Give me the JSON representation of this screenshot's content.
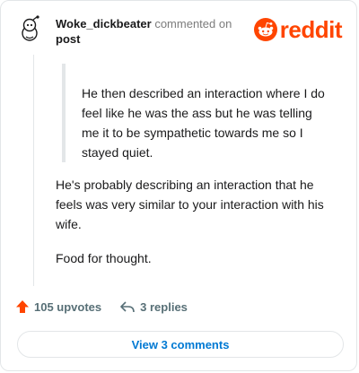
{
  "comment": {
    "username": "Woke_dickbeater",
    "action_text": "commented on",
    "post_link": "post",
    "quote": "He then described an interaction where I do feel like he was the ass but he was telling me it to be sympathetic towards me so I stayed quiet.",
    "paragraphs": [
      "He's probably describing an interaction that he feels was very similar to your interaction with his wife.",
      "Food for thought."
    ]
  },
  "brand": {
    "name": "reddit",
    "color": "#ff4500",
    "icon": "reddit-snoo-icon"
  },
  "footer": {
    "upvotes": "105 upvotes",
    "replies": "3 replies",
    "view_comments": "View 3 comments",
    "upvote_color": "#ff4500",
    "link_color": "#0079d3"
  }
}
